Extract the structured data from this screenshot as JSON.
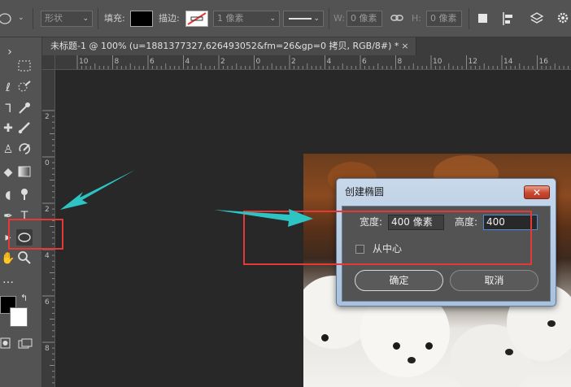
{
  "options_bar": {
    "mode_value": "形状",
    "fill_label": "填充:",
    "stroke_label": "描边:",
    "stroke_width_value": "1 像素",
    "w_label": "W:",
    "w_value": "0 像素",
    "h_label": "H:",
    "h_value": "0 像素",
    "fill_color": "#000000"
  },
  "document_tab": {
    "title": "未标题-1 @ 100% (u=1881377327,626493052&fm=26&gp=0 拷贝, RGB/8#) *",
    "close": "×"
  },
  "rulers": {
    "horizontal_ticks": [
      "10",
      "8",
      "6",
      "4",
      "2",
      "0",
      "2",
      "4",
      "6",
      "8",
      "10",
      "12",
      "14",
      "16",
      "18"
    ],
    "vertical_ticks": [
      "2",
      "0",
      "2",
      "4",
      "6",
      "8"
    ]
  },
  "toolbox": {
    "tools": [
      "marquee-icon",
      "lasso-icon",
      "quick-select-icon",
      "eyedropper-icon",
      "healing-icon",
      "brush-icon",
      "stamp-icon",
      "history-brush-icon",
      "eraser-icon",
      "gradient-icon",
      "blur-icon",
      "dodge-icon",
      "pen-icon",
      "type-icon",
      "path-select-icon",
      "ellipse-icon",
      "hand-icon",
      "zoom-icon"
    ],
    "foreground_color": "#000000",
    "background_color": "#ffffff"
  },
  "dialog": {
    "title": "创建椭圆",
    "width_label": "宽度:",
    "width_value": "400 像素",
    "height_label": "高度:",
    "height_value": "400",
    "from_center_label": "从中心",
    "from_center_checked": false,
    "ok_label": "确定",
    "cancel_label": "取消"
  },
  "annotation_colors": {
    "highlight_box": "#e53935",
    "arrow": "#2ec4c4"
  }
}
